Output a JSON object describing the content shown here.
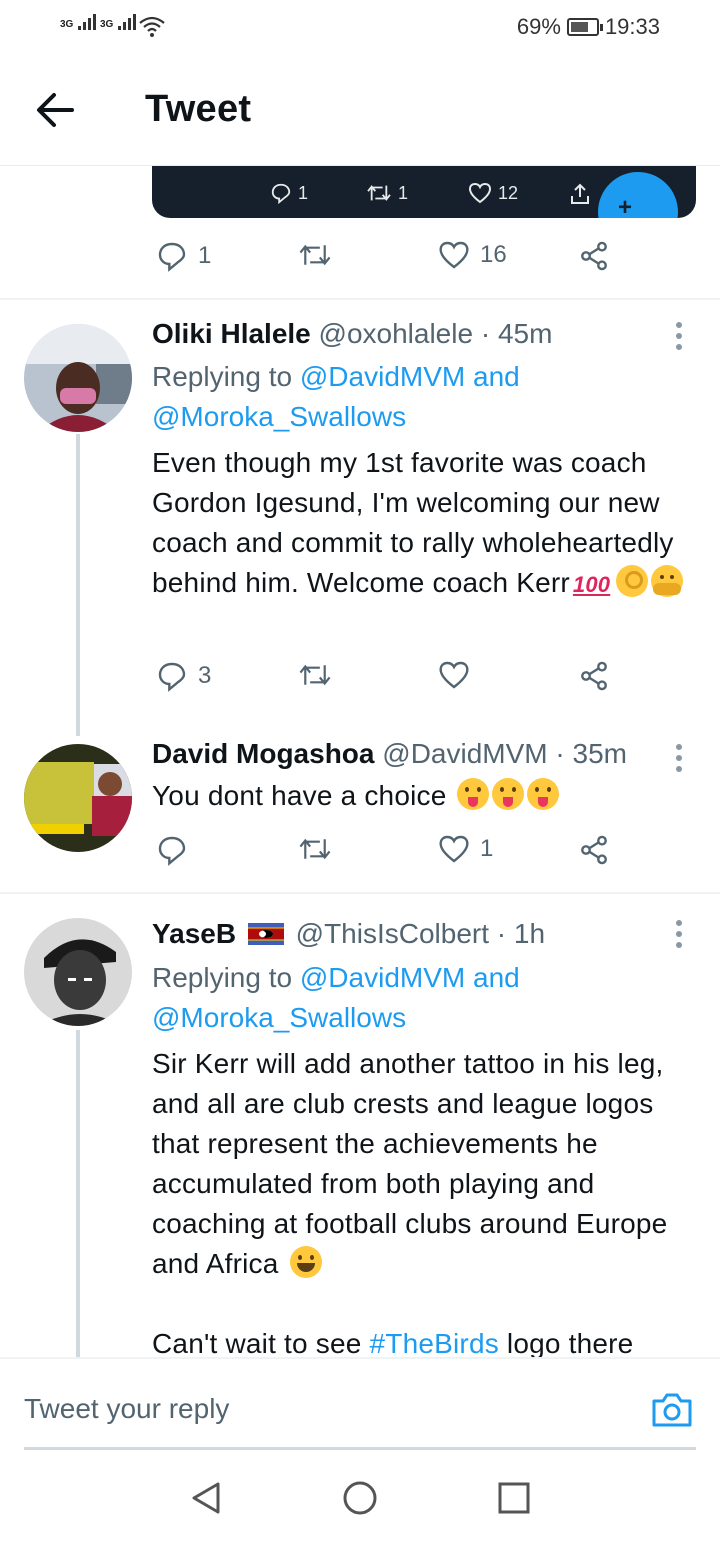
{
  "status_bar": {
    "signal_1": "3G",
    "signal_2": "3G",
    "battery_percent": "69%",
    "battery_level": 0.69,
    "time": "19:33"
  },
  "header": {
    "title": "Tweet"
  },
  "embedded_card": {
    "replies": "1",
    "retweets": "1",
    "likes": "12"
  },
  "main_tweet_actions": {
    "replies": "1",
    "retweets": "",
    "likes": "16"
  },
  "replies": [
    {
      "name": "Oliki Hlalele",
      "handle": "@oxohlalele",
      "time": "· 45m",
      "replying_prefix": "Replying to",
      "replying_to_1": "@DavidMVM",
      "replying_and": "and",
      "replying_to_2": "@Moroka_Swallows",
      "body": "Even though my 1st favorite was coach Gordon Igesund, I'm welcoming our new coach and commit to rally wholeheartedly behind him. Welcome coach Kerr",
      "emojis": [
        "hundred-points-emoji",
        "ok-hand-emoji",
        "hugging-face-emoji"
      ],
      "reply_count": "3",
      "retweet_count": "",
      "like_count": ""
    },
    {
      "name": "David Mogashoa",
      "handle": "@DavidMVM",
      "time": "· 35m",
      "body": "You dont have a choice",
      "emojis": [
        "tongue-face-emoji",
        "tongue-face-emoji",
        "tongue-face-emoji"
      ],
      "reply_count": "",
      "retweet_count": "",
      "like_count": "1"
    },
    {
      "name": "YaseB",
      "handle": "@ThisIsColbert",
      "time": "· 1h",
      "flag": "eswatini-flag-emoji",
      "replying_prefix": "Replying to",
      "replying_to_1": "@DavidMVM",
      "replying_and": "and",
      "replying_to_2": "@Moroka_Swallows",
      "body": "Sir Kerr will add another tattoo in his leg, and all are club crests and league logos that represent the achievements he accumulated from both playing and coaching at football clubs around Europe and Africa",
      "emojis": [
        "laughing-face-emoji"
      ],
      "body2_prefix": "Can't wait to see",
      "body2_hashtag": "#TheBirds",
      "body2_suffix": "logo there"
    }
  ],
  "reply_bar": {
    "placeholder": "Tweet your reply"
  },
  "colors": {
    "accent": "#1d9bf0",
    "text": "#0f1419",
    "secondary": "#536471",
    "card_bg": "#16202c"
  }
}
